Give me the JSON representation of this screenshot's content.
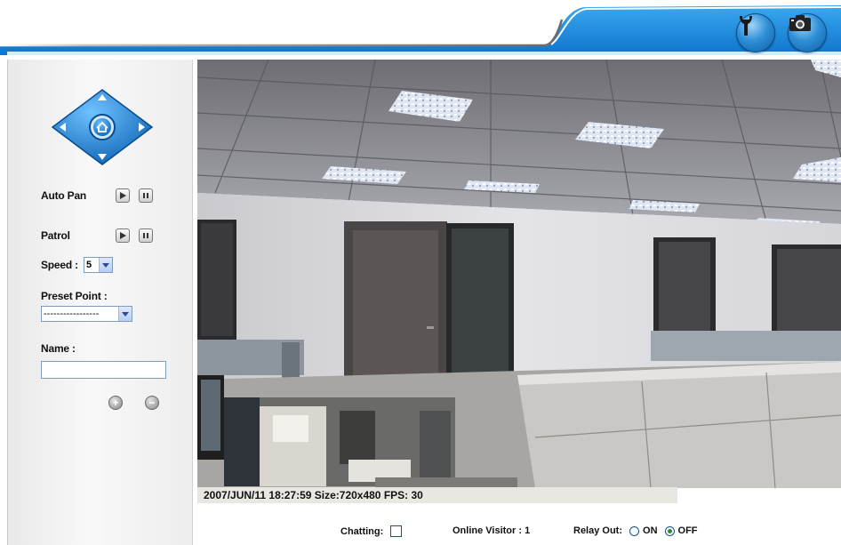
{
  "header": {
    "settings_icon": "wrench-icon",
    "snapshot_icon": "camera-icon",
    "accent": "#1d8ae0"
  },
  "ptz": {
    "dpad_icon": "dpad-icon",
    "home_icon": "home-icon",
    "auto_pan_label": "Auto Pan",
    "patrol_label": "Patrol",
    "speed_label": "Speed :",
    "speed_value": "5",
    "preset_label": "Preset Point :",
    "preset_value": "-----------------",
    "name_label": "Name :",
    "name_value": "",
    "add_icon": "plus-icon",
    "remove_icon": "minus-icon"
  },
  "video": {
    "overlay_text": "2007/JUN/11 18:27:59 Size:720x480 FPS: 30"
  },
  "bottom": {
    "chatting_label": "Chatting:",
    "chatting_checked": false,
    "online_visitor_label": "Online Visitor : 1",
    "relay_label": "Relay Out:",
    "relay_on_label": "ON",
    "relay_off_label": "OFF",
    "relay_selected": "OFF"
  }
}
